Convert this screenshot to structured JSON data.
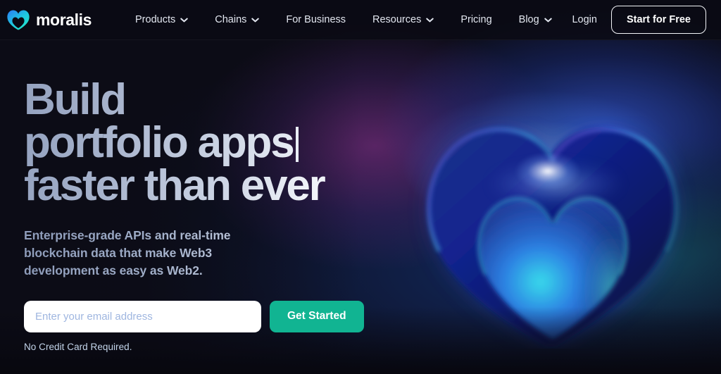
{
  "brand": {
    "name": "moralis",
    "logo_icon": "moralis-heart-logo",
    "logo_gradient_from": "#2b7cf6",
    "logo_gradient_to": "#23e6c8"
  },
  "nav": {
    "items": [
      {
        "label": "Products",
        "has_dropdown": true,
        "icon": "chevron-down-icon"
      },
      {
        "label": "Chains",
        "has_dropdown": true,
        "icon": "chevron-down-icon"
      },
      {
        "label": "For Business",
        "has_dropdown": false,
        "icon": ""
      },
      {
        "label": "Resources",
        "has_dropdown": true,
        "icon": "chevron-down-icon"
      },
      {
        "label": "Pricing",
        "has_dropdown": false,
        "icon": ""
      },
      {
        "label": "Blog",
        "has_dropdown": true,
        "icon": "chevron-down-icon"
      }
    ],
    "login_label": "Login",
    "cta_label": "Start for Free"
  },
  "hero": {
    "headline": "Build\nportfolio apps",
    "headline_line3": "faster than ever",
    "subhead": "Enterprise-grade APIs and real-time\nblockchain data that make Web3\ndevelopment as easy as Web2.",
    "email_placeholder": "Enter your email address",
    "email_value": "",
    "submit_label": "Get Started",
    "fineprint": "No Credit Card Required.",
    "accent_green": "#11b492",
    "background_color": "#0c0c16",
    "graphic_icon": "moralis-heart-graphic"
  }
}
